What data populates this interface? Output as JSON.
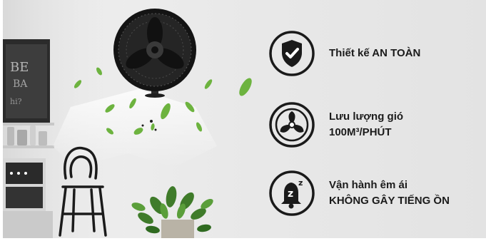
{
  "features": [
    {
      "icon": "shield-check-icon",
      "lines": [
        "Thiết kế AN TOÀN"
      ]
    },
    {
      "icon": "fan-icon",
      "lines": [
        "Lưu lượng gió",
        "100M³/PHÚT"
      ]
    },
    {
      "icon": "alarm-bell-zzz-icon",
      "lines": [
        "Vận hành êm ái",
        "KHÔNG GÂY TIẾNG ỒN"
      ]
    }
  ],
  "colors": {
    "icon": "#1a1a1a",
    "text": "#1b1b1b",
    "leaf": "#6db33f",
    "background": "#e8e8e8"
  }
}
